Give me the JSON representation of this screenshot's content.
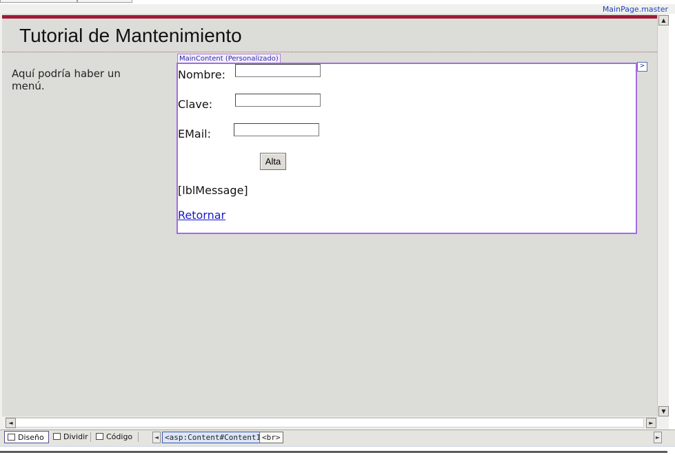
{
  "master_page": "MainPage.master",
  "page": {
    "title": "Tutorial de Mantenimiento",
    "menu_placeholder": "Aquí podría haber un menú."
  },
  "content_region": {
    "label": "MainContent (Personalizado)",
    "smart_tag": ">"
  },
  "form": {
    "nombre_label": "Nombre:",
    "nombre_value": "",
    "clave_label": "Clave:",
    "clave_value": "",
    "email_label": "EMail:",
    "email_value": "",
    "submit_label": "Alta",
    "message": "[lblMessage]",
    "back_link": "Retornar"
  },
  "view_tabs": [
    {
      "label": "Diseño",
      "active": true
    },
    {
      "label": "Dividir",
      "active": false
    },
    {
      "label": "Código",
      "active": false
    }
  ],
  "breadcrumbs": [
    "<asp:Content#Content1>",
    "<br>"
  ],
  "icons": {
    "scroll_up": "▲",
    "scroll_down": "▼",
    "scroll_left": "◄",
    "scroll_right": "►",
    "crumb_prev": "◄",
    "crumb_next": "►"
  },
  "colors": {
    "header_bar": "#a01a36",
    "content_border": "#a56be0",
    "link": "#1616c8"
  }
}
